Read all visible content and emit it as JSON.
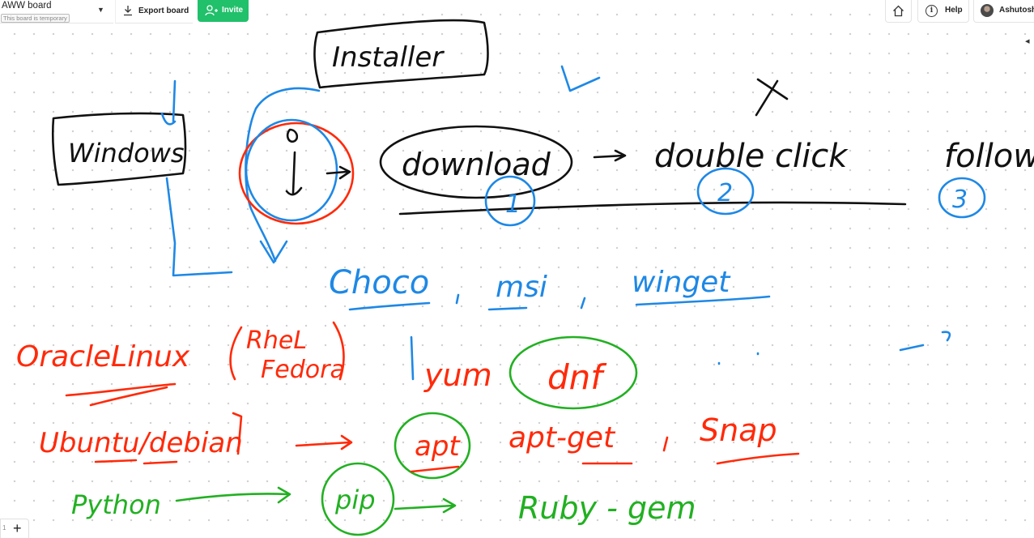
{
  "toolbar": {
    "board_title": "AWW board",
    "temporary_note": "This board is temporary",
    "export_label": "Export board",
    "invite_label": "Invite",
    "help_label": "Help",
    "user_name": "Ashutosh"
  },
  "bottom": {
    "page_number": "1",
    "add_label": "+"
  },
  "colors": {
    "invite_green": "#21c06b",
    "ink_blue": "#1e88e5",
    "ink_red": "#ff2a0a",
    "ink_black": "#111111",
    "ink_green": "#22b022"
  },
  "whiteboard": {
    "installer": "Installer",
    "windows": "Windows",
    "exe_mark": "i",
    "download": "download",
    "double_click": "double click",
    "follow": "follow",
    "step_1": "1",
    "step_2": "2",
    "step_3": "3",
    "choco": "Choco",
    "msi": "msi",
    "winget": "winget",
    "oracle_linux": "OracleLinux",
    "rhel": "RheL",
    "fedora": "Fedora",
    "yum": "yum",
    "dnf": "dnf",
    "ubuntu_debian": "Ubuntu/debian",
    "apt": "apt",
    "apt_get": "apt-get",
    "snap": "Snap",
    "python": "Python",
    "pip": "pip",
    "ruby_gem": "Ruby - gem"
  }
}
